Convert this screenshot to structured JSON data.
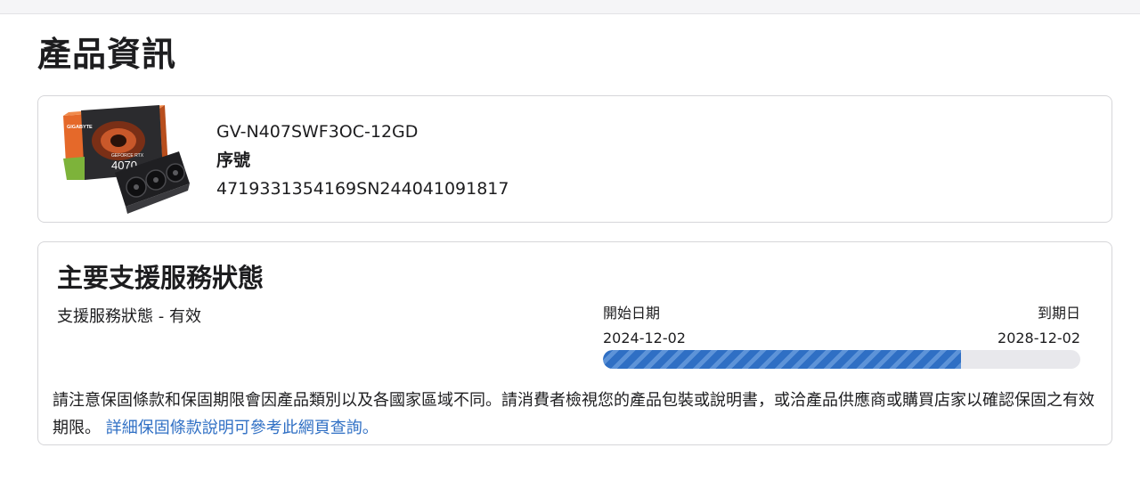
{
  "page": {
    "title": "產品資訊"
  },
  "product": {
    "model": "GV-N407SWF3OC-12GD",
    "serial_label": "序號",
    "serial_number": "4719331354169SN244041091817",
    "image_text": {
      "brand": "GIGABYTE",
      "series": "GEFORCE RTX",
      "model_number": "4070"
    }
  },
  "support": {
    "title": "主要支援服務狀態",
    "status_text": "支援服務狀態 - 有效",
    "start_label": "開始日期",
    "start_date": "2024-12-02",
    "end_label": "到期日",
    "end_date": "2028-12-02",
    "progress_fraction": 0.75,
    "notice_text": "請注意保固條款和保固期限會因產品類別以及各國家區域不同。請消費者檢視您的產品包裝或說明書，或洽產品供應商或購買店家以確認保固之有效期限。",
    "notice_link": "詳細保固條款說明可參考此網頁查詢。"
  },
  "colors": {
    "accent": "#2f6fc4",
    "border": "#d6d6d9",
    "track": "#e8e8ec"
  }
}
